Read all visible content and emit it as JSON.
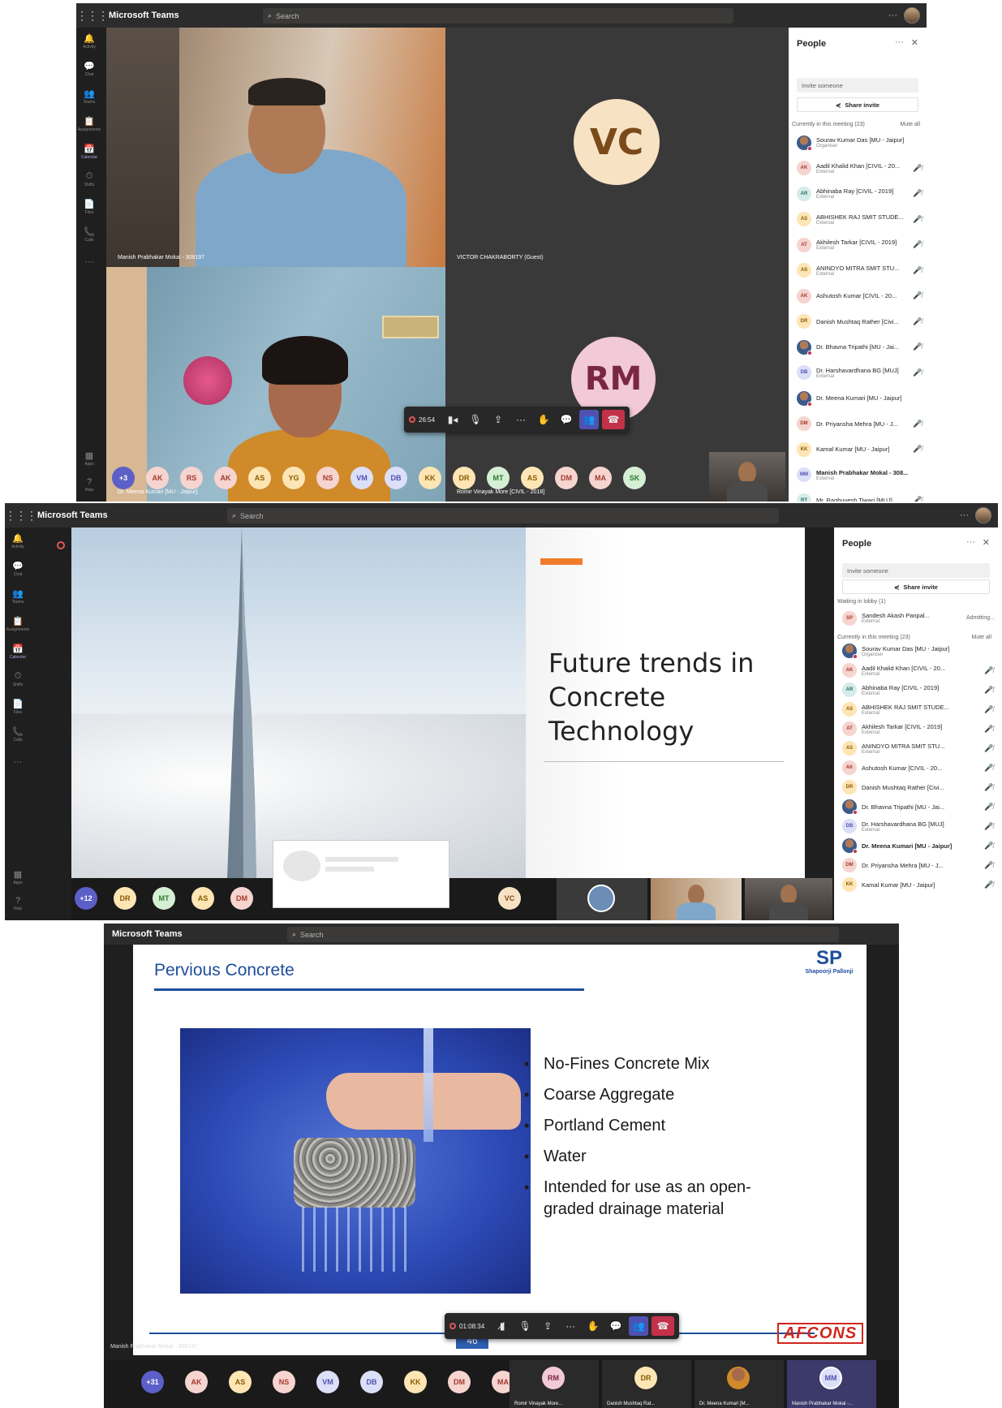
{
  "app": {
    "name": "Microsoft Teams",
    "search_placeholder": "Search",
    "more": "···"
  },
  "rail": [
    {
      "label": "Activity",
      "glyph": "🔔"
    },
    {
      "label": "Chat",
      "glyph": "💬"
    },
    {
      "label": "Teams",
      "glyph": "👥"
    },
    {
      "label": "Assignments",
      "glyph": "📋"
    },
    {
      "label": "Calendar",
      "glyph": "📅"
    },
    {
      "label": "Shifts",
      "glyph": "⏱"
    },
    {
      "label": "Files",
      "glyph": "📄"
    },
    {
      "label": "Calls",
      "glyph": "📞"
    },
    {
      "label": "",
      "glyph": "···"
    },
    {
      "label": "Apps",
      "glyph": "▦"
    },
    {
      "label": "Help",
      "glyph": "?"
    }
  ],
  "colors": {
    "accent": "#5b5fc7",
    "hangup": "#c4314b",
    "titlebar": "#2d2c2c",
    "panel": "#ffffff"
  },
  "shot1": {
    "tiles": [
      {
        "name": "Manish Prabhakar Mokal - 308197"
      },
      {
        "name": "VICTOR CHAKRABORTY (Guest)",
        "initials": "VC"
      },
      {
        "name": "Dr. Meena Kumari [MU - Jaipur]"
      },
      {
        "name": "Romir Vinayak More [CIVIL - 2018]",
        "initials": "RM"
      }
    ],
    "controls": {
      "time": "26:54"
    },
    "roster_more": "+3",
    "roster": [
      "AK",
      "RS",
      "AK",
      "AS",
      "YG",
      "NS",
      "VM",
      "DB",
      "KK",
      "DR",
      "MT",
      "AS",
      "DM",
      "MA",
      "SK"
    ],
    "people": {
      "title": "People",
      "invite_placeholder": "Invite someone",
      "share": "Share invite",
      "current": "Currently in this meeting (23)",
      "mute_all": "Mute all",
      "list": [
        {
          "initials": "SD",
          "name": "Sourav Kumar Das [MU - Jaipur]",
          "role": "Organiser",
          "photo": true
        },
        {
          "initials": "AK",
          "name": "Aadil Khalid Khan [CIVIL - 20...",
          "role": "External"
        },
        {
          "initials": "AR",
          "name": "Abhinaba Ray [CIVIL - 2019]",
          "role": "External"
        },
        {
          "initials": "AS",
          "name": "ABHISHEK RAJ SMIT STUDE...",
          "role": "External"
        },
        {
          "initials": "AT",
          "name": "Akhilesh Tarkar [CIVIL - 2019]",
          "role": "External"
        },
        {
          "initials": "AS",
          "name": "ANINDYO MITRA SMIT STU...",
          "role": "External"
        },
        {
          "initials": "AK",
          "name": "Ashutosh Kumar [CIVIL - 20...",
          "role": ""
        },
        {
          "initials": "DR",
          "name": "Danish Mushtaq Rather [Civi...",
          "role": ""
        },
        {
          "initials": "BT",
          "name": "Dr. Bhavna Tripathi [MU - Jai...",
          "role": "",
          "photo": true
        },
        {
          "initials": "DB",
          "name": "Dr. Harshavardhana BG [MUJ]",
          "role": "External"
        },
        {
          "initials": "MK",
          "name": "Dr. Meena Kumari [MU - Jaipur]",
          "role": "",
          "photo": true
        },
        {
          "initials": "DM",
          "name": "Dr. Priyansha Mehra [MU - J...",
          "role": ""
        },
        {
          "initials": "KK",
          "name": "Kamal Kumar [MU - Jaipur]",
          "role": ""
        },
        {
          "initials": "MM",
          "name": "Manish Prabhakar Mokal - 308...",
          "role": "External",
          "bold": true
        },
        {
          "initials": "RT",
          "name": "Mr. Raghuvesh Tiwari [MUJ]",
          "role": ""
        }
      ]
    }
  },
  "shot2": {
    "slide": {
      "title": "Future trends in Concrete Technology"
    },
    "roster_more": "+12",
    "roster": [
      "DR",
      "MT",
      "AS",
      "DM"
    ],
    "strip_vc": "VC",
    "people": {
      "title": "People",
      "invite_placeholder": "Invite someone",
      "share": "Share invite",
      "lobby": "Waiting in lobby (1)",
      "lobby_person": {
        "initials": "SP",
        "name": "Sandesh Akash Panpal...",
        "role": "External",
        "status": "Admitting..."
      },
      "current": "Currently in this meeting (23)",
      "mute_all": "Mute all",
      "list": [
        {
          "initials": "SD",
          "name": "Sourav Kumar Das [MU - Jaipur]",
          "role": "Organiser",
          "photo": true
        },
        {
          "initials": "AK",
          "name": "Aadil Khalid Khan [CIVIL - 20...",
          "role": "External"
        },
        {
          "initials": "AR",
          "name": "Abhinaba Ray [CIVIL - 2019]",
          "role": "External"
        },
        {
          "initials": "AS",
          "name": "ABHISHEK RAJ SMIT STUDE...",
          "role": "External"
        },
        {
          "initials": "AT",
          "name": "Akhilesh Tarkar [CIVIL - 2019]",
          "role": "External"
        },
        {
          "initials": "AS",
          "name": "ANINDYO MITRA SMIT STU...",
          "role": "External"
        },
        {
          "initials": "AK",
          "name": "Ashutosh Kumar [CIVIL - 20...",
          "role": ""
        },
        {
          "initials": "DR",
          "name": "Danish Mushtaq Rather [Civi...",
          "role": ""
        },
        {
          "initials": "BT",
          "name": "Dr. Bhavna Tripathi [MU - Jai...",
          "role": "",
          "photo": true
        },
        {
          "initials": "DB",
          "name": "Dr. Harshavardhana BG [MUJ]",
          "role": "External"
        },
        {
          "initials": "MK",
          "name": "Dr. Meena Kumari [MU - Jaipur]",
          "role": "",
          "photo": true,
          "bold": true
        },
        {
          "initials": "DM",
          "name": "Dr. Priyansha Mehra [MU - J...",
          "role": ""
        },
        {
          "initials": "KK",
          "name": "Kamal Kumar [MU - Jaipur]",
          "role": ""
        }
      ]
    }
  },
  "shot3": {
    "slide": {
      "title": "Pervious Concrete",
      "brand": "Shapoorji Pallonji",
      "bullets": [
        "No-Fines Concrete Mix",
        "Coarse Aggregate",
        "Portland Cement",
        "Water",
        "Intended for use as an open-graded drainage material"
      ],
      "page": "46",
      "footer_logo": "AFCONS",
      "presenter": "Manish Prabhakar Mokal - 308197"
    },
    "controls": {
      "time": "01:08:34"
    },
    "roster_more": "+31",
    "roster": [
      "AK",
      "AS",
      "NS",
      "VM",
      "DB",
      "KK",
      "DM",
      "MA"
    ],
    "strip": [
      {
        "initials": "RM",
        "name": "Romir Vinayak More..."
      },
      {
        "initials": "DR",
        "name": "Danish Mushtaq Rat..."
      },
      {
        "initials": "",
        "name": "Dr. Meena Kumari [M..."
      },
      {
        "initials": "MM",
        "name": "Manish Prabhakar Mokal -..."
      }
    ]
  }
}
